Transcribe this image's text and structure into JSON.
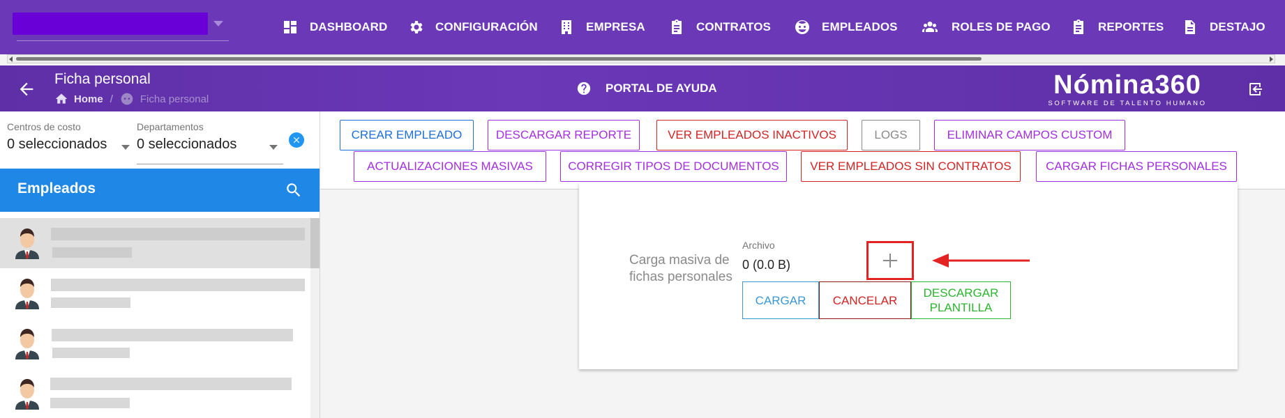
{
  "nav": {
    "items": [
      {
        "label": "DASHBOARD",
        "icon": "dashboard-icon"
      },
      {
        "label": "CONFIGURACIÓN",
        "icon": "gear-icon"
      },
      {
        "label": "EMPRESA",
        "icon": "building-icon"
      },
      {
        "label": "CONTRATOS",
        "icon": "clipboard-icon"
      },
      {
        "label": "EMPLEADOS",
        "icon": "face-icon"
      },
      {
        "label": "ROLES DE PAGO",
        "icon": "people-icon"
      },
      {
        "label": "REPORTES",
        "icon": "clipboard-icon"
      },
      {
        "label": "DESTAJO",
        "icon": "document-icon"
      }
    ]
  },
  "header": {
    "title": "Ficha personal",
    "breadcrumb_home": "Home",
    "breadcrumb_sep": "/",
    "breadcrumb_current": "Ficha personal",
    "help_label": "PORTAL DE AYUDA",
    "logo_main": "Nómina360",
    "logo_sub": "SOFTWARE DE TALENTO HUMANO"
  },
  "filters": {
    "cost_centers_label": "Centros de costo",
    "cost_centers_value": "0 seleccionados",
    "departments_label": "Departamentos",
    "departments_value": "0 seleccionados"
  },
  "employees": {
    "title": "Empleados"
  },
  "actions": {
    "crear": "CREAR EMPLEADO",
    "descargar_reporte": "DESCARGAR REPORTE",
    "inactivos": "VER EMPLEADOS INACTIVOS",
    "logs": "LOGS",
    "eliminar": "ELIMINAR CAMPOS CUSTOM",
    "masivas": "ACTUALIZACIONES MASIVAS",
    "corregir": "CORREGIR TIPOS DE DOCUMENTOS",
    "sin_contratos": "VER EMPLEADOS SIN CONTRATOS",
    "cargar_fichas": "CARGAR FICHAS PERSONALES"
  },
  "upload": {
    "label": "Carga masiva de fichas personales",
    "file_label": "Archivo",
    "file_value": "0 (0.0 B)",
    "cargar": "CARGAR",
    "cancelar": "CANCELAR",
    "descargar_plantilla": "DESCARGAR PLANTILLA"
  },
  "colors": {
    "nav_bg": "#6b38b8",
    "accent_blue": "#1f87e5",
    "annotation_red": "#e32222"
  }
}
